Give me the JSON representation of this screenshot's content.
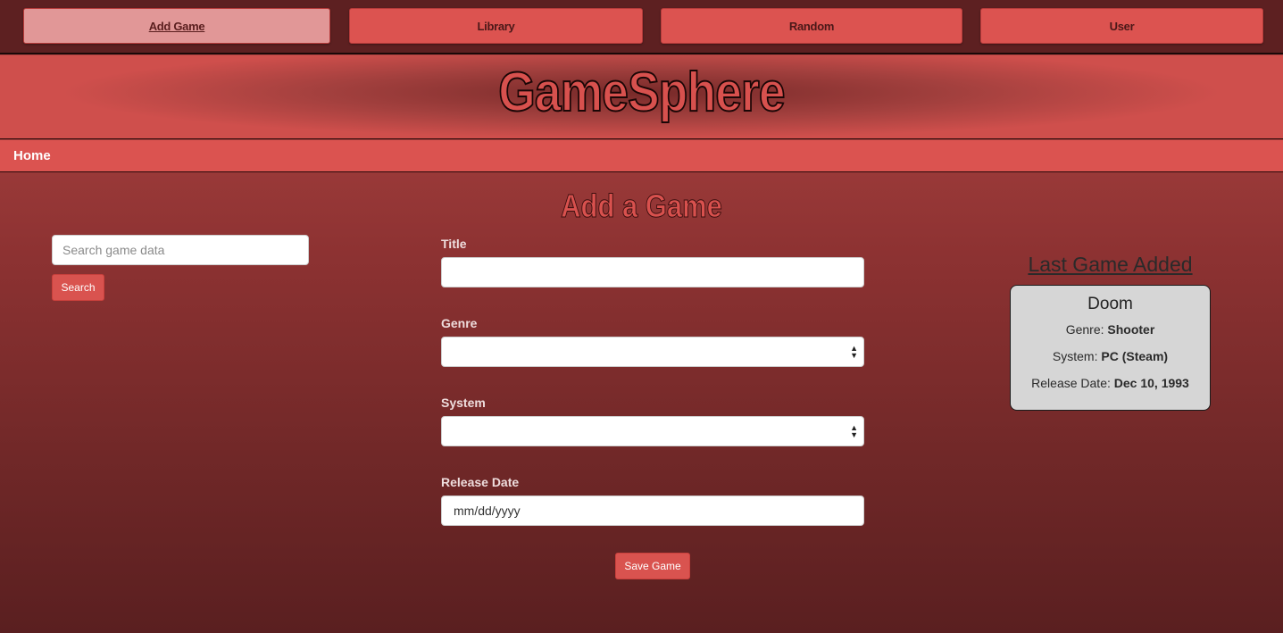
{
  "nav": {
    "items": [
      {
        "label": "Add Game",
        "active": true
      },
      {
        "label": "Library",
        "active": false
      },
      {
        "label": "Random",
        "active": false
      },
      {
        "label": "User",
        "active": false
      }
    ]
  },
  "banner": {
    "title": "GameSphere"
  },
  "breadcrumb": {
    "home": "Home"
  },
  "page": {
    "heading": "Add a Game"
  },
  "search": {
    "placeholder": "Search game data",
    "button": "Search"
  },
  "form": {
    "title_label": "Title",
    "title_value": "",
    "genre_label": "Genre",
    "genre_value": "",
    "system_label": "System",
    "system_value": "",
    "release_label": "Release Date",
    "release_value": "mm/dd/yyyy",
    "save_button": "Save Game"
  },
  "last_game": {
    "heading": "Last Game Added",
    "title": "Doom",
    "genre_label": "Genre:",
    "genre": "Shooter",
    "system_label": "System:",
    "system": "PC (Steam)",
    "release_label": "Release Date:",
    "release": "Dec 10, 1993"
  },
  "colors": {
    "accent": "#d9534f",
    "topbar": "#5d2021",
    "active_tab": "#e19797",
    "card_bg": "#d6d6d6"
  }
}
